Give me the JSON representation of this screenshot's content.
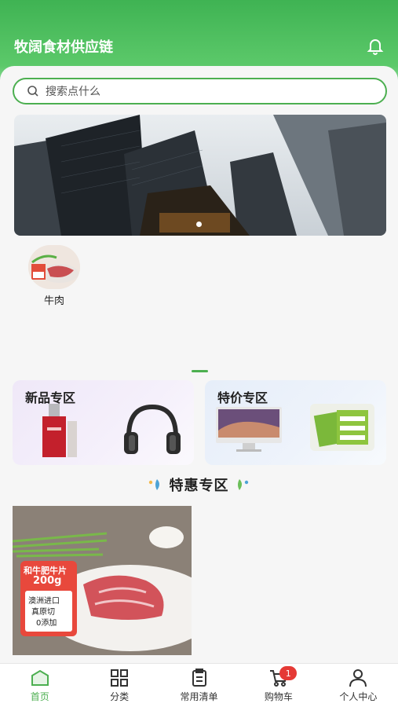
{
  "header": {
    "title": "牧阔食材供应链",
    "bell_icon": "bell-icon"
  },
  "search": {
    "placeholder": "搜索点什么",
    "icon": "search-icon"
  },
  "categories": [
    {
      "label": "牛肉"
    }
  ],
  "promos": [
    {
      "title": "新品专区"
    },
    {
      "title": "特价专区"
    }
  ],
  "section": {
    "title": "特惠专区"
  },
  "product_card": {
    "tag": "和牛肥牛片",
    "weight": "200g",
    "notes": [
      "澳洲进口",
      "真原切",
      "0添加"
    ]
  },
  "tabbar": {
    "items": [
      {
        "label": "首页",
        "icon": "home-icon",
        "active": true
      },
      {
        "label": "分类",
        "icon": "grid-icon",
        "active": false
      },
      {
        "label": "常用清单",
        "icon": "clipboard-icon",
        "active": false
      },
      {
        "label": "购物车",
        "icon": "cart-icon",
        "active": false,
        "badge": "1"
      },
      {
        "label": "个人中心",
        "icon": "user-icon",
        "active": false
      }
    ]
  },
  "colors": {
    "accent": "#4caf50",
    "badge": "#e53935"
  }
}
